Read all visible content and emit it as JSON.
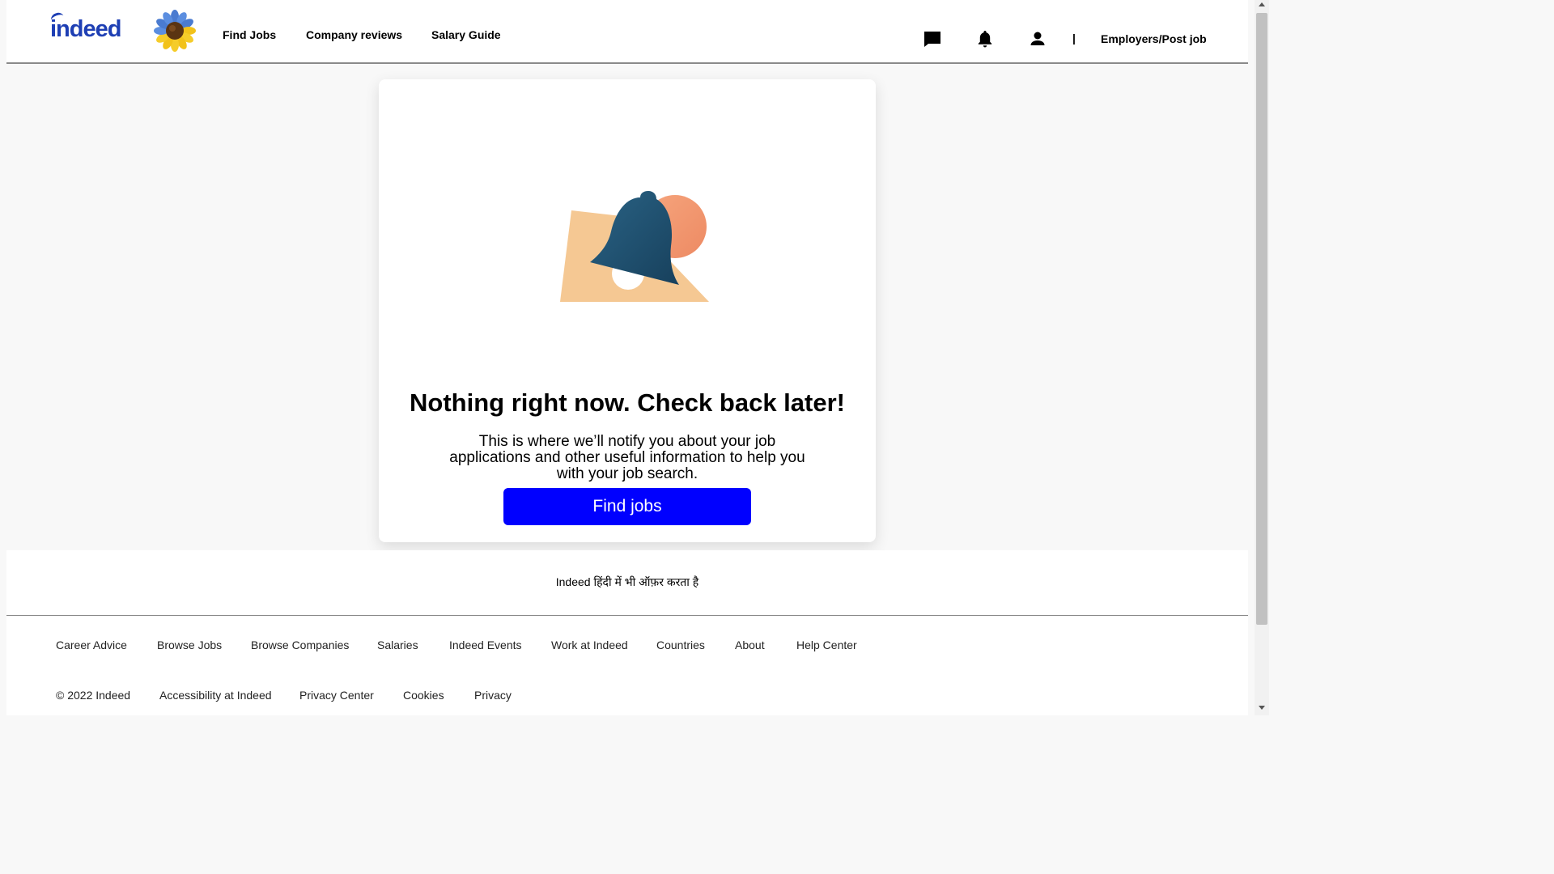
{
  "header": {
    "logo_text": "indeed",
    "nav": [
      "Find Jobs",
      "Company reviews",
      "Salary Guide"
    ],
    "icons": [
      "messages-icon",
      "notifications-bell-icon",
      "profile-icon"
    ],
    "separator": "|",
    "employers_link": "Employers/Post job"
  },
  "main": {
    "heading": "Nothing right now. Check back later!",
    "message": "This is where we’ll notify you about your job applications and other useful information to help you with your job search.",
    "button_label": "Find jobs",
    "button_color": "#0000ff"
  },
  "language_offer": "Indeed हिंदी में भी ऑफ़र करता है",
  "footer": {
    "links_row1": [
      "Career Advice",
      "Browse Jobs",
      "Browse Companies",
      "Salaries",
      "Indeed Events",
      "Work at Indeed",
      "Countries",
      "About",
      "Help Center"
    ],
    "links_row2": [
      "© 2022 Indeed",
      "Accessibility at Indeed",
      "Privacy Center",
      "Cookies",
      "Privacy"
    ]
  },
  "colors": {
    "logo": "#1e3fb4",
    "bell": "#1f4f6e",
    "paper": "#f5c893",
    "sun": "#f2956b"
  }
}
